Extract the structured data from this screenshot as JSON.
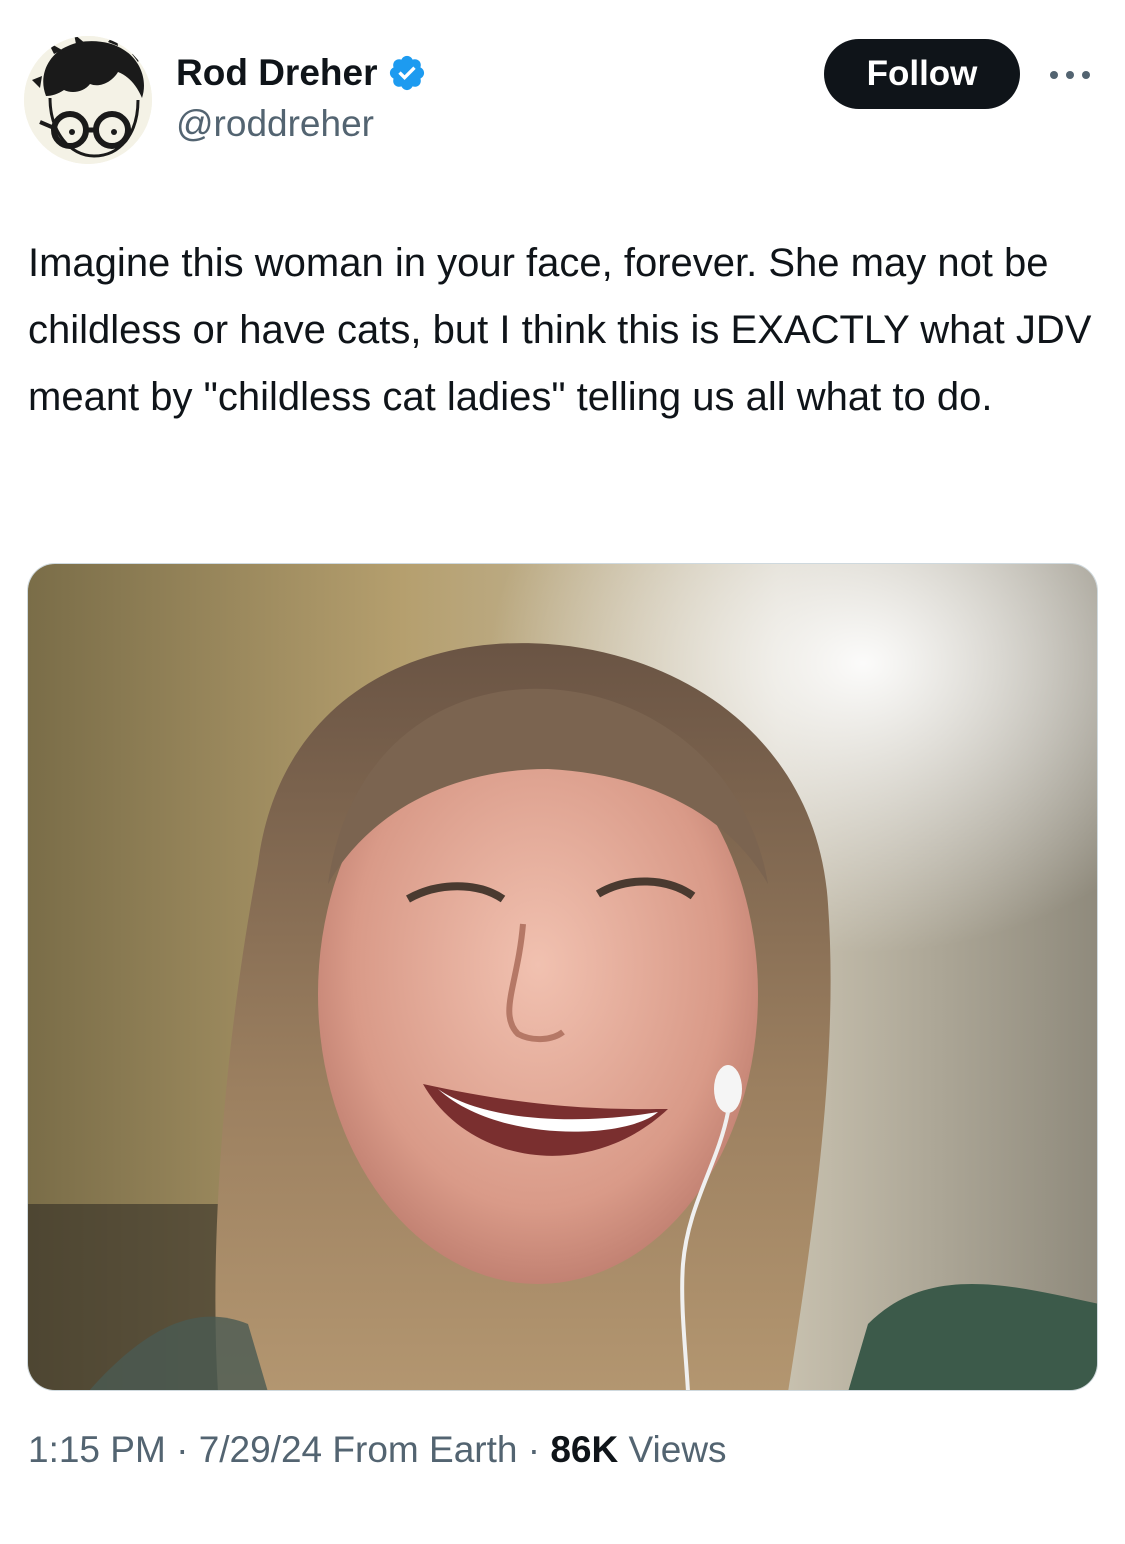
{
  "author": {
    "display_name": "Rod Dreher",
    "handle": "@roddreher",
    "verified": true,
    "avatar_icon": "cartoon-face-with-glasses-avatar"
  },
  "actions": {
    "follow_label": "Follow",
    "more_icon": "more-horizontal-icon"
  },
  "tweet": {
    "text": "Imagine this woman in your face, forever. She may not be childless or have cats, but I think this is EXACTLY what JDV meant by \"childless cat ladies\" telling us all what to do."
  },
  "media": {
    "kind": "photo"
  },
  "meta": {
    "time": "1:15 PM",
    "separator": "·",
    "date": "7/29/24",
    "source": "From Earth",
    "views_count": "86K",
    "views_label": "Views"
  },
  "colors": {
    "text_primary": "#0f1419",
    "text_secondary": "#536471",
    "verified_blue": "#1d9bf0",
    "follow_bg": "#0f1419",
    "follow_text": "#ffffff"
  }
}
